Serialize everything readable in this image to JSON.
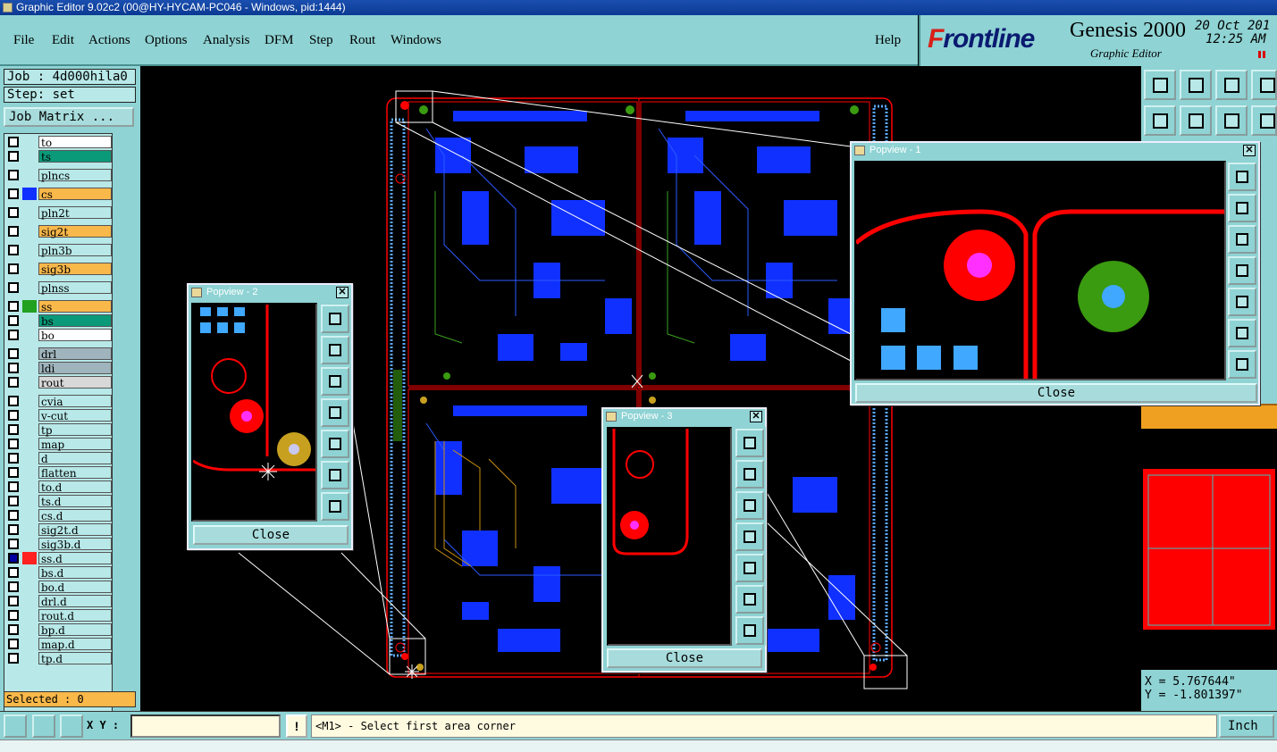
{
  "window": {
    "title": "Graphic Editor 9.02c2 (00@HY-HYCAM-PC046 - Windows, pid:1444)"
  },
  "menu": [
    "File",
    "Edit",
    "Actions",
    "Options",
    "Analysis",
    "DFM",
    "Step",
    "Rout",
    "Windows"
  ],
  "help": "Help",
  "brand": {
    "logo_f": "F",
    "logo_rest": "rontline",
    "product": "Genesis 2000",
    "subtitle": "Graphic Editor",
    "date": "20 Oct 201",
    "time": "12:25 AM"
  },
  "job": "Job : 4d000hila0",
  "step": "Step: set",
  "job_matrix": "Job Matrix ...",
  "layers": [
    {
      "name": "to",
      "color": "#ffffff",
      "swatch": ""
    },
    {
      "name": "ts",
      "color": "#0a9a7a",
      "swatch": ""
    },
    {
      "name": "plncs",
      "color": "#b8e8e8",
      "swatch": ""
    },
    {
      "name": "cs",
      "color": "#f9b84a",
      "swatch": "#1030ff"
    },
    {
      "name": "pln2t",
      "color": "#b8e8e8",
      "swatch": ""
    },
    {
      "name": "sig2t",
      "color": "#f9b84a",
      "swatch": ""
    },
    {
      "name": "pln3b",
      "color": "#b8e8e8",
      "swatch": ""
    },
    {
      "name": "sig3b",
      "color": "#f9b84a",
      "swatch": ""
    },
    {
      "name": "plnss",
      "color": "#b8e8e8",
      "swatch": ""
    },
    {
      "name": "ss",
      "color": "#f9b84a",
      "swatch": "#22a020"
    },
    {
      "name": "bs",
      "color": "#0a9a7a",
      "swatch": ""
    },
    {
      "name": "bo",
      "color": "#ffffff",
      "swatch": ""
    },
    {
      "name": "drl",
      "color": "#9fb4bc",
      "swatch": ""
    },
    {
      "name": "ldi",
      "color": "#9fb4bc",
      "swatch": ""
    },
    {
      "name": "rout",
      "color": "#d8d8d8",
      "swatch": ""
    },
    {
      "name": "cvia",
      "color": "#b8e8e8",
      "swatch": ""
    },
    {
      "name": "v-cut",
      "color": "#b8e8e8",
      "swatch": ""
    },
    {
      "name": "tp",
      "color": "#b8e8e8",
      "swatch": ""
    },
    {
      "name": "map",
      "color": "#b8e8e8",
      "swatch": ""
    },
    {
      "name": "d",
      "color": "#b8e8e8",
      "swatch": ""
    },
    {
      "name": "flatten",
      "color": "#b8e8e8",
      "swatch": ""
    },
    {
      "name": "to.d",
      "color": "#b8e8e8",
      "swatch": ""
    },
    {
      "name": "ts.d",
      "color": "#b8e8e8",
      "swatch": ""
    },
    {
      "name": "cs.d",
      "color": "#b8e8e8",
      "swatch": ""
    },
    {
      "name": "sig2t.d",
      "color": "#b8e8e8",
      "swatch": ""
    },
    {
      "name": "sig3b.d",
      "color": "#b8e8e8",
      "swatch": ""
    },
    {
      "name": "ss.d",
      "color": "#b8e8e8",
      "swatch": "#ff2020",
      "active": true
    },
    {
      "name": "bs.d",
      "color": "#b8e8e8",
      "swatch": ""
    },
    {
      "name": "bo.d",
      "color": "#b8e8e8",
      "swatch": ""
    },
    {
      "name": "drl.d",
      "color": "#b8e8e8",
      "swatch": ""
    },
    {
      "name": "rout.d",
      "color": "#b8e8e8",
      "swatch": ""
    },
    {
      "name": "bp.d",
      "color": "#b8e8e8",
      "swatch": ""
    },
    {
      "name": "map.d",
      "color": "#b8e8e8",
      "swatch": ""
    },
    {
      "name": "tp.d",
      "color": "#b8e8e8",
      "swatch": ""
    }
  ],
  "selected": "Selected : 0",
  "popviews": [
    {
      "title": "Popview - 1",
      "close": "Close"
    },
    {
      "title": "Popview - 2",
      "close": "Close"
    },
    {
      "title": "Popview - 3",
      "close": "Close"
    }
  ],
  "coords": {
    "x": "X =  5.767644\"",
    "y": "Y = -1.801397\""
  },
  "status": {
    "xy_label": "X Y :",
    "xy_value": "",
    "bang": "!",
    "message": "<M1> - Select first area corner",
    "units": "Inch"
  },
  "colors": {
    "panel": "#8fd3d4",
    "copper": "#1030ff",
    "pad_red": "#ff0000",
    "pad_green": "#3a9a10",
    "pad_gold": "#c8a020",
    "magenta": "#ff30ff",
    "lightblue": "#40a8ff"
  }
}
